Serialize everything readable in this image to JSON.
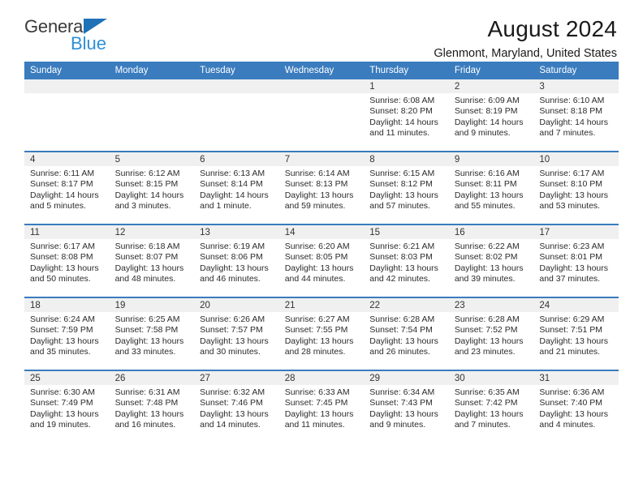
{
  "logo": {
    "word_one": "General",
    "word_two": "Blue",
    "triangle_color": "#1f72b8",
    "blue_color": "#2e8fd6"
  },
  "header": {
    "title": "August 2024",
    "subtitle": "Glenmont, Maryland, United States"
  },
  "theme": {
    "header_band": "#3a7cbe",
    "daynum_band": "#f0f0f0",
    "row_divider": "#3a7cbe"
  },
  "calendar": {
    "weekday_headers": [
      "Sunday",
      "Monday",
      "Tuesday",
      "Wednesday",
      "Thursday",
      "Friday",
      "Saturday"
    ],
    "weeks": [
      [
        {
          "day": "",
          "lines": []
        },
        {
          "day": "",
          "lines": []
        },
        {
          "day": "",
          "lines": []
        },
        {
          "day": "",
          "lines": []
        },
        {
          "day": "1",
          "lines": [
            "Sunrise: 6:08 AM",
            "Sunset: 8:20 PM",
            "Daylight: 14 hours",
            "and 11 minutes."
          ]
        },
        {
          "day": "2",
          "lines": [
            "Sunrise: 6:09 AM",
            "Sunset: 8:19 PM",
            "Daylight: 14 hours",
            "and 9 minutes."
          ]
        },
        {
          "day": "3",
          "lines": [
            "Sunrise: 6:10 AM",
            "Sunset: 8:18 PM",
            "Daylight: 14 hours",
            "and 7 minutes."
          ]
        }
      ],
      [
        {
          "day": "4",
          "lines": [
            "Sunrise: 6:11 AM",
            "Sunset: 8:17 PM",
            "Daylight: 14 hours",
            "and 5 minutes."
          ]
        },
        {
          "day": "5",
          "lines": [
            "Sunrise: 6:12 AM",
            "Sunset: 8:15 PM",
            "Daylight: 14 hours",
            "and 3 minutes."
          ]
        },
        {
          "day": "6",
          "lines": [
            "Sunrise: 6:13 AM",
            "Sunset: 8:14 PM",
            "Daylight: 14 hours",
            "and 1 minute."
          ]
        },
        {
          "day": "7",
          "lines": [
            "Sunrise: 6:14 AM",
            "Sunset: 8:13 PM",
            "Daylight: 13 hours",
            "and 59 minutes."
          ]
        },
        {
          "day": "8",
          "lines": [
            "Sunrise: 6:15 AM",
            "Sunset: 8:12 PM",
            "Daylight: 13 hours",
            "and 57 minutes."
          ]
        },
        {
          "day": "9",
          "lines": [
            "Sunrise: 6:16 AM",
            "Sunset: 8:11 PM",
            "Daylight: 13 hours",
            "and 55 minutes."
          ]
        },
        {
          "day": "10",
          "lines": [
            "Sunrise: 6:17 AM",
            "Sunset: 8:10 PM",
            "Daylight: 13 hours",
            "and 53 minutes."
          ]
        }
      ],
      [
        {
          "day": "11",
          "lines": [
            "Sunrise: 6:17 AM",
            "Sunset: 8:08 PM",
            "Daylight: 13 hours",
            "and 50 minutes."
          ]
        },
        {
          "day": "12",
          "lines": [
            "Sunrise: 6:18 AM",
            "Sunset: 8:07 PM",
            "Daylight: 13 hours",
            "and 48 minutes."
          ]
        },
        {
          "day": "13",
          "lines": [
            "Sunrise: 6:19 AM",
            "Sunset: 8:06 PM",
            "Daylight: 13 hours",
            "and 46 minutes."
          ]
        },
        {
          "day": "14",
          "lines": [
            "Sunrise: 6:20 AM",
            "Sunset: 8:05 PM",
            "Daylight: 13 hours",
            "and 44 minutes."
          ]
        },
        {
          "day": "15",
          "lines": [
            "Sunrise: 6:21 AM",
            "Sunset: 8:03 PM",
            "Daylight: 13 hours",
            "and 42 minutes."
          ]
        },
        {
          "day": "16",
          "lines": [
            "Sunrise: 6:22 AM",
            "Sunset: 8:02 PM",
            "Daylight: 13 hours",
            "and 39 minutes."
          ]
        },
        {
          "day": "17",
          "lines": [
            "Sunrise: 6:23 AM",
            "Sunset: 8:01 PM",
            "Daylight: 13 hours",
            "and 37 minutes."
          ]
        }
      ],
      [
        {
          "day": "18",
          "lines": [
            "Sunrise: 6:24 AM",
            "Sunset: 7:59 PM",
            "Daylight: 13 hours",
            "and 35 minutes."
          ]
        },
        {
          "day": "19",
          "lines": [
            "Sunrise: 6:25 AM",
            "Sunset: 7:58 PM",
            "Daylight: 13 hours",
            "and 33 minutes."
          ]
        },
        {
          "day": "20",
          "lines": [
            "Sunrise: 6:26 AM",
            "Sunset: 7:57 PM",
            "Daylight: 13 hours",
            "and 30 minutes."
          ]
        },
        {
          "day": "21",
          "lines": [
            "Sunrise: 6:27 AM",
            "Sunset: 7:55 PM",
            "Daylight: 13 hours",
            "and 28 minutes."
          ]
        },
        {
          "day": "22",
          "lines": [
            "Sunrise: 6:28 AM",
            "Sunset: 7:54 PM",
            "Daylight: 13 hours",
            "and 26 minutes."
          ]
        },
        {
          "day": "23",
          "lines": [
            "Sunrise: 6:28 AM",
            "Sunset: 7:52 PM",
            "Daylight: 13 hours",
            "and 23 minutes."
          ]
        },
        {
          "day": "24",
          "lines": [
            "Sunrise: 6:29 AM",
            "Sunset: 7:51 PM",
            "Daylight: 13 hours",
            "and 21 minutes."
          ]
        }
      ],
      [
        {
          "day": "25",
          "lines": [
            "Sunrise: 6:30 AM",
            "Sunset: 7:49 PM",
            "Daylight: 13 hours",
            "and 19 minutes."
          ]
        },
        {
          "day": "26",
          "lines": [
            "Sunrise: 6:31 AM",
            "Sunset: 7:48 PM",
            "Daylight: 13 hours",
            "and 16 minutes."
          ]
        },
        {
          "day": "27",
          "lines": [
            "Sunrise: 6:32 AM",
            "Sunset: 7:46 PM",
            "Daylight: 13 hours",
            "and 14 minutes."
          ]
        },
        {
          "day": "28",
          "lines": [
            "Sunrise: 6:33 AM",
            "Sunset: 7:45 PM",
            "Daylight: 13 hours",
            "and 11 minutes."
          ]
        },
        {
          "day": "29",
          "lines": [
            "Sunrise: 6:34 AM",
            "Sunset: 7:43 PM",
            "Daylight: 13 hours",
            "and 9 minutes."
          ]
        },
        {
          "day": "30",
          "lines": [
            "Sunrise: 6:35 AM",
            "Sunset: 7:42 PM",
            "Daylight: 13 hours",
            "and 7 minutes."
          ]
        },
        {
          "day": "31",
          "lines": [
            "Sunrise: 6:36 AM",
            "Sunset: 7:40 PM",
            "Daylight: 13 hours",
            "and 4 minutes."
          ]
        }
      ]
    ]
  }
}
